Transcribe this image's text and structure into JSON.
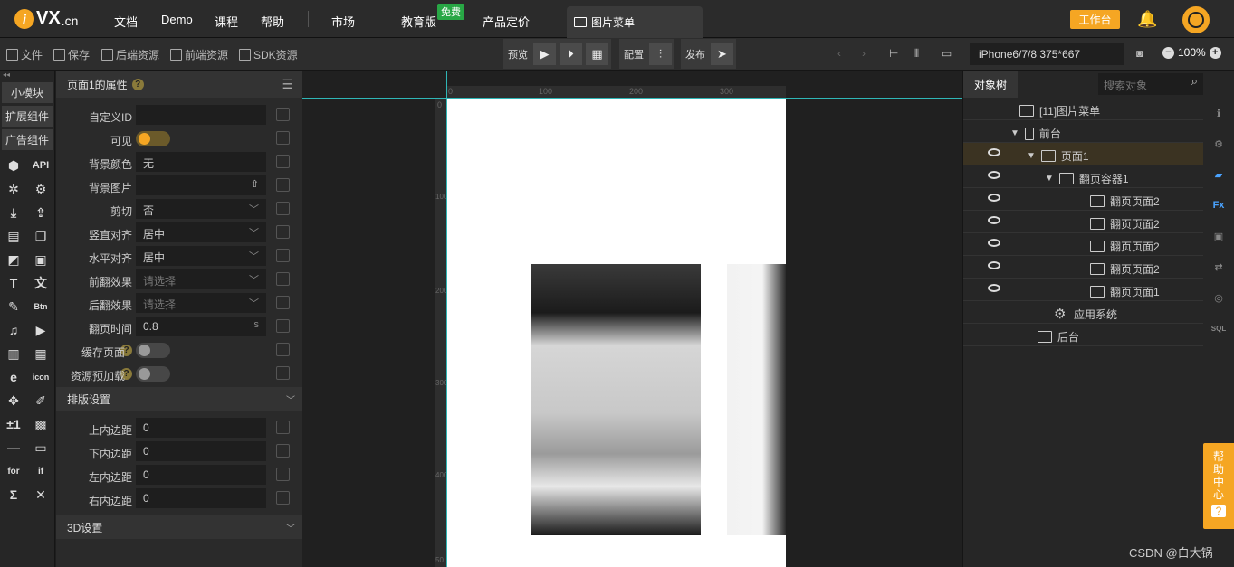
{
  "header": {
    "logo_i": "i",
    "logo_text": "VX",
    "logo_domain": ".cn",
    "nav": [
      "文档",
      "Demo",
      "课程",
      "帮助",
      "市场",
      "教育版",
      "产品定价"
    ],
    "free_badge": "免费",
    "active_tab": "图片菜单",
    "workbench_button": "工作台"
  },
  "toolbar": {
    "file": "文件",
    "save": "保存",
    "backend_resources": "后端资源",
    "frontend_resources": "前端资源",
    "sdk_resources": "SDK资源",
    "preview": "预览",
    "config": "配置",
    "publish": "发布",
    "device": "iPhone6/7/8 375*667",
    "zoom": "100%"
  },
  "left_strip": {
    "tabs": [
      "小模块",
      "扩展组件",
      "广告组件"
    ],
    "api_label": "API",
    "btn_label": "Btn",
    "icon_label": "icon",
    "plusminus": "±1",
    "for_label": "for",
    "if_label": "if"
  },
  "props": {
    "title": "页面1的属性",
    "rows": [
      {
        "label": "自定义ID",
        "type": "text",
        "value": ""
      },
      {
        "label": "可见",
        "type": "toggle-on",
        "value": ""
      },
      {
        "label": "背景颜色",
        "type": "text",
        "value": "无"
      },
      {
        "label": "背景图片",
        "type": "upload",
        "value": ""
      },
      {
        "label": "剪切",
        "type": "select",
        "value": "否"
      },
      {
        "label": "竖直对齐",
        "type": "select",
        "value": "居中"
      },
      {
        "label": "水平对齐",
        "type": "select",
        "value": "居中"
      },
      {
        "label": "前翻效果",
        "type": "select-placeholder",
        "value": "请选择"
      },
      {
        "label": "后翻效果",
        "type": "select-placeholder",
        "value": "请选择"
      },
      {
        "label": "翻页时间",
        "type": "number-unit",
        "value": "0.8",
        "unit": "s"
      },
      {
        "label": "缓存页面",
        "type": "toggle-off",
        "value": ""
      },
      {
        "label": "资源预加载",
        "type": "toggle-off",
        "value": ""
      }
    ],
    "layout_section": "排版设置",
    "padding_rows": [
      {
        "label": "上内边距",
        "value": "0"
      },
      {
        "label": "下内边距",
        "value": "0"
      },
      {
        "label": "左内边距",
        "value": "0"
      },
      {
        "label": "右内边距",
        "value": "0"
      }
    ],
    "section_3d": "3D设置"
  },
  "canvas": {
    "ruler_h": [
      "0",
      "100",
      "200",
      "300"
    ],
    "ruler_v": [
      "0",
      "100",
      "200",
      "300",
      "400",
      "50"
    ]
  },
  "tree": {
    "tab": "对象树",
    "search_placeholder": "搜索对象",
    "nodes": [
      {
        "label": "[11]图片菜单",
        "eye": false,
        "icon": "app-icon"
      },
      {
        "label": "前台",
        "eye": false,
        "icon": "phone-icon",
        "toggle": "▼"
      },
      {
        "label": "页面1",
        "eye": true,
        "icon": "page-icon",
        "toggle": "▼",
        "selected": true
      },
      {
        "label": "翻页容器1",
        "eye": true,
        "icon": "flip-container-icon",
        "toggle": "▼"
      },
      {
        "label": "翻页页面2",
        "eye": true,
        "icon": "flip-page-icon"
      },
      {
        "label": "翻页页面2",
        "eye": true,
        "icon": "flip-page-icon"
      },
      {
        "label": "翻页页面2",
        "eye": true,
        "icon": "flip-page-icon"
      },
      {
        "label": "翻页页面2",
        "eye": true,
        "icon": "flip-page-icon"
      },
      {
        "label": "翻页页面1",
        "eye": true,
        "icon": "flip-page-icon"
      },
      {
        "label": "应用系统",
        "eye": false,
        "icon": "gear-icon"
      },
      {
        "label": "后台",
        "eye": false,
        "icon": "backend-icon"
      }
    ]
  },
  "right_strip": {
    "fx_label": "Fx",
    "sql_label": "SQL",
    "help_chars": [
      "帮",
      "助",
      "中",
      "心",
      "?"
    ]
  },
  "watermark": "CSDN @白大锅",
  "colors": {
    "accent": "#f5a623",
    "guide": "#2fb6b6",
    "free_badge": "#28a745"
  }
}
